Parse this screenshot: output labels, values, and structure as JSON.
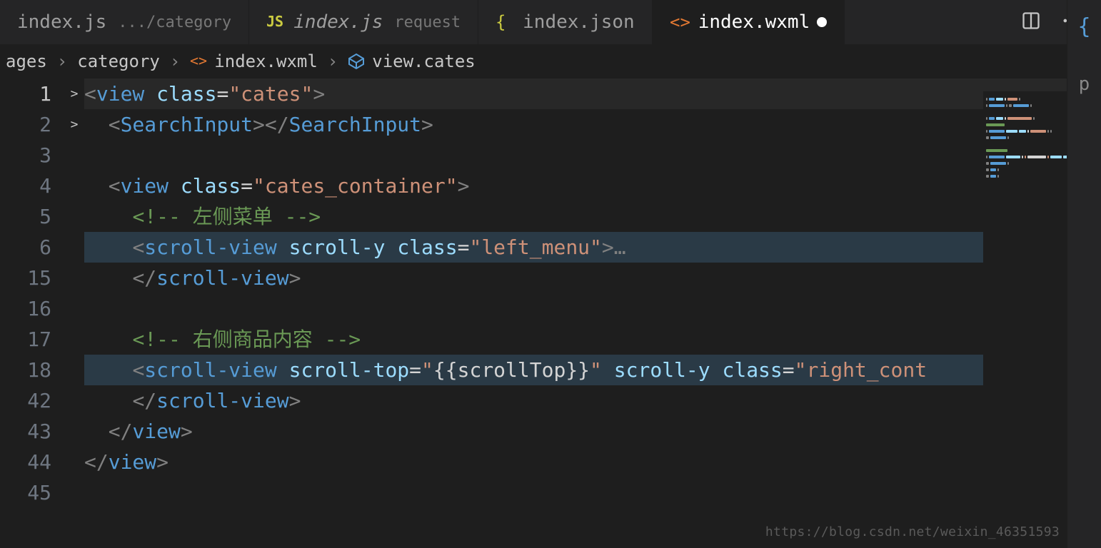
{
  "tabs": [
    {
      "icon": "js",
      "label": "index.js",
      "sublabel": ".../category",
      "italic": false,
      "active": false,
      "modified": false
    },
    {
      "icon": "js",
      "label": "index.js",
      "sublabel": "request",
      "italic": true,
      "active": false,
      "modified": false
    },
    {
      "icon": "braces",
      "label": "index.json",
      "sublabel": "",
      "italic": false,
      "active": false,
      "modified": false
    },
    {
      "icon": "angle",
      "label": "index.wxml",
      "sublabel": "",
      "italic": false,
      "active": true,
      "modified": true
    }
  ],
  "editor_actions": {
    "split": "split",
    "more": "more"
  },
  "breadcrumbs": [
    {
      "type": "text",
      "label": "ages"
    },
    {
      "type": "text",
      "label": "category"
    },
    {
      "type": "file-angle",
      "label": "index.wxml"
    },
    {
      "type": "cube",
      "label": "view.cates"
    }
  ],
  "gutter_lines": [
    "1",
    "2",
    "3",
    "4",
    "5",
    "6",
    "15",
    "16",
    "17",
    "18",
    "42",
    "43",
    "44",
    "45"
  ],
  "fold_lines": {
    "6": ">",
    "18": ">"
  },
  "code_lines": [
    {
      "n": "1",
      "hl": false,
      "current": true,
      "tokens": [
        {
          "t": "<",
          "c": "bracket"
        },
        {
          "t": "view",
          "c": "tag"
        },
        {
          "t": " ",
          "c": "plain"
        },
        {
          "t": "class",
          "c": "attr"
        },
        {
          "t": "=",
          "c": "eq"
        },
        {
          "t": "\"cates\"",
          "c": "str"
        },
        {
          "t": ">",
          "c": "bracket"
        }
      ]
    },
    {
      "n": "2",
      "hl": false,
      "tokens": [
        {
          "t": "  ",
          "c": "plain"
        },
        {
          "t": "<",
          "c": "bracket"
        },
        {
          "t": "SearchInput",
          "c": "tag"
        },
        {
          "t": ">",
          "c": "bracket"
        },
        {
          "t": "</",
          "c": "bracket"
        },
        {
          "t": "SearchInput",
          "c": "tag"
        },
        {
          "t": ">",
          "c": "bracket"
        }
      ]
    },
    {
      "n": "3",
      "hl": false,
      "tokens": []
    },
    {
      "n": "4",
      "hl": false,
      "tokens": [
        {
          "t": "  ",
          "c": "plain"
        },
        {
          "t": "<",
          "c": "bracket"
        },
        {
          "t": "view",
          "c": "tag"
        },
        {
          "t": " ",
          "c": "plain"
        },
        {
          "t": "class",
          "c": "attr"
        },
        {
          "t": "=",
          "c": "eq"
        },
        {
          "t": "\"cates_container\"",
          "c": "str"
        },
        {
          "t": ">",
          "c": "bracket"
        }
      ]
    },
    {
      "n": "5",
      "hl": false,
      "tokens": [
        {
          "t": "    ",
          "c": "plain"
        },
        {
          "t": "<!-- 左侧菜单 -->",
          "c": "comment"
        }
      ]
    },
    {
      "n": "6",
      "hl": true,
      "tokens": [
        {
          "t": "    ",
          "c": "plain"
        },
        {
          "t": "<",
          "c": "bracket"
        },
        {
          "t": "scroll-view",
          "c": "tag"
        },
        {
          "t": " ",
          "c": "plain"
        },
        {
          "t": "scroll-y",
          "c": "attr"
        },
        {
          "t": " ",
          "c": "plain"
        },
        {
          "t": "class",
          "c": "attr"
        },
        {
          "t": "=",
          "c": "eq"
        },
        {
          "t": "\"left_menu\"",
          "c": "str"
        },
        {
          "t": ">",
          "c": "bracket"
        },
        {
          "t": "…",
          "c": "fold"
        }
      ]
    },
    {
      "n": "15",
      "hl": false,
      "tokens": [
        {
          "t": "    ",
          "c": "plain"
        },
        {
          "t": "</",
          "c": "bracket"
        },
        {
          "t": "scroll-view",
          "c": "tag"
        },
        {
          "t": ">",
          "c": "bracket"
        }
      ]
    },
    {
      "n": "16",
      "hl": false,
      "tokens": []
    },
    {
      "n": "17",
      "hl": false,
      "tokens": [
        {
          "t": "    ",
          "c": "plain"
        },
        {
          "t": "<!-- 右侧商品内容 -->",
          "c": "comment"
        }
      ]
    },
    {
      "n": "18",
      "hl": true,
      "tokens": [
        {
          "t": "    ",
          "c": "plain"
        },
        {
          "t": "<",
          "c": "bracket"
        },
        {
          "t": "scroll-view",
          "c": "tag"
        },
        {
          "t": " ",
          "c": "plain"
        },
        {
          "t": "scroll-top",
          "c": "attr"
        },
        {
          "t": "=",
          "c": "eq"
        },
        {
          "t": "\"",
          "c": "str"
        },
        {
          "t": "{{scrollTop}}",
          "c": "expr"
        },
        {
          "t": "\"",
          "c": "str"
        },
        {
          "t": " ",
          "c": "plain"
        },
        {
          "t": "scroll-y",
          "c": "attr"
        },
        {
          "t": " ",
          "c": "plain"
        },
        {
          "t": "class",
          "c": "attr"
        },
        {
          "t": "=",
          "c": "eq"
        },
        {
          "t": "\"right_cont",
          "c": "str"
        }
      ]
    },
    {
      "n": "42",
      "hl": false,
      "tokens": [
        {
          "t": "    ",
          "c": "plain"
        },
        {
          "t": "</",
          "c": "bracket"
        },
        {
          "t": "scroll-view",
          "c": "tag"
        },
        {
          "t": ">",
          "c": "bracket"
        }
      ]
    },
    {
      "n": "43",
      "hl": false,
      "tokens": [
        {
          "t": "  ",
          "c": "plain"
        },
        {
          "t": "</",
          "c": "bracket"
        },
        {
          "t": "view",
          "c": "tag"
        },
        {
          "t": ">",
          "c": "bracket"
        }
      ]
    },
    {
      "n": "44",
      "hl": false,
      "tokens": [
        {
          "t": "</",
          "c": "bracket"
        },
        {
          "t": "view",
          "c": "tag"
        },
        {
          "t": ">",
          "c": "bracket"
        }
      ]
    },
    {
      "n": "45",
      "hl": false,
      "tokens": []
    }
  ],
  "right_panel": {
    "brace_icon": "{",
    "letter": "p"
  },
  "watermark": "https://blog.csdn.net/weixin_46351593"
}
